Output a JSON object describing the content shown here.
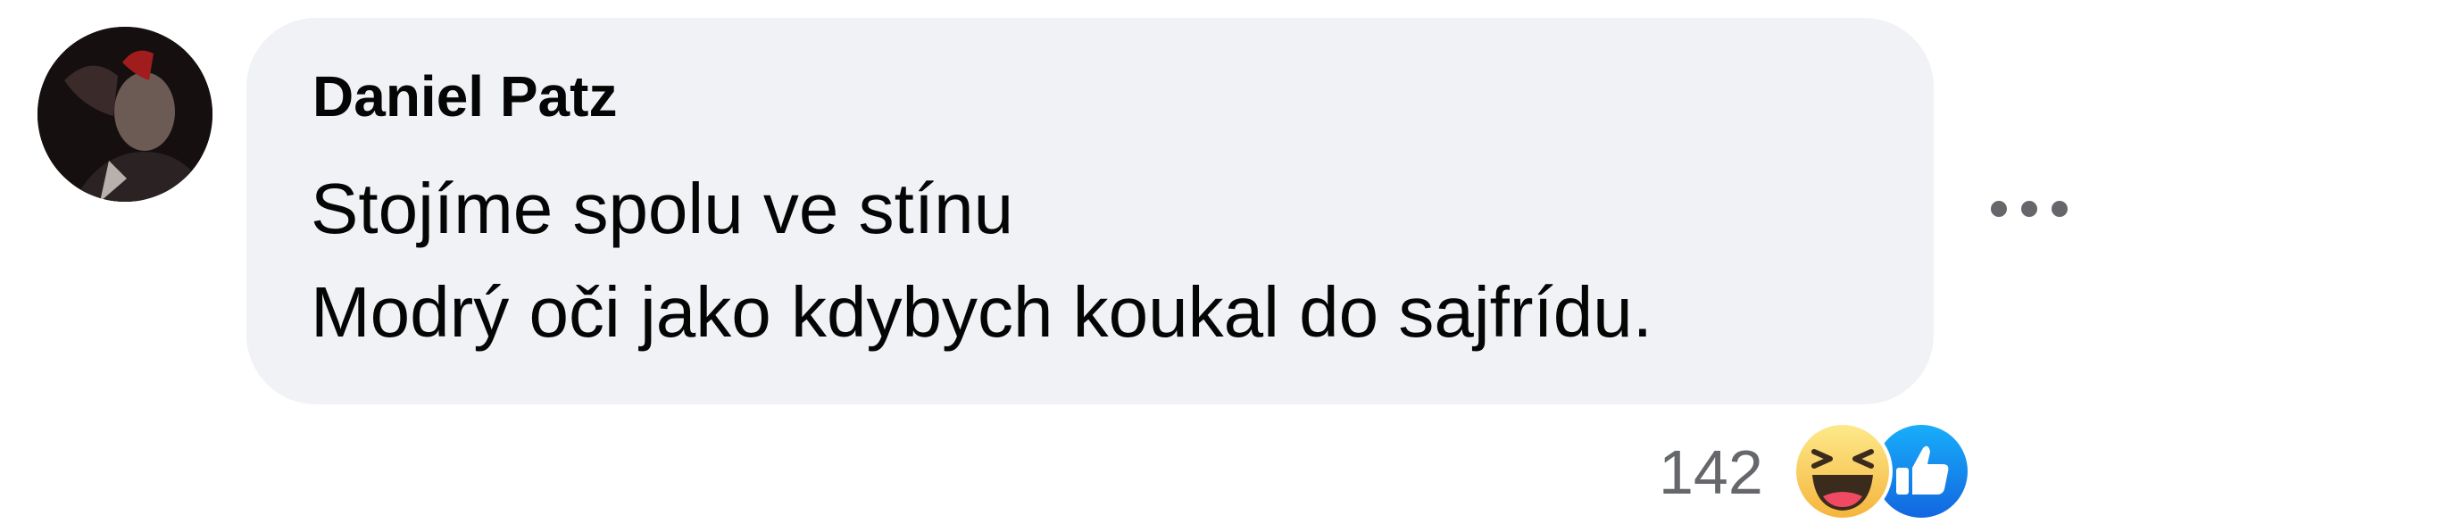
{
  "comment": {
    "author": "Daniel Patz",
    "lines": [
      "Stojíme spolu ve stínu",
      "Modrý oči jako kdybych koukal do sajfrídu."
    ]
  },
  "reactions": {
    "count": "142",
    "icons": [
      "haha-emoji-icon",
      "like-thumbs-up-icon"
    ]
  },
  "colors": {
    "bubble_bg": "#f0f2f5",
    "text": "#050505",
    "secondary_text": "#65676b",
    "like_blue": "#1877f2",
    "haha_yellow": "#f7c544"
  }
}
